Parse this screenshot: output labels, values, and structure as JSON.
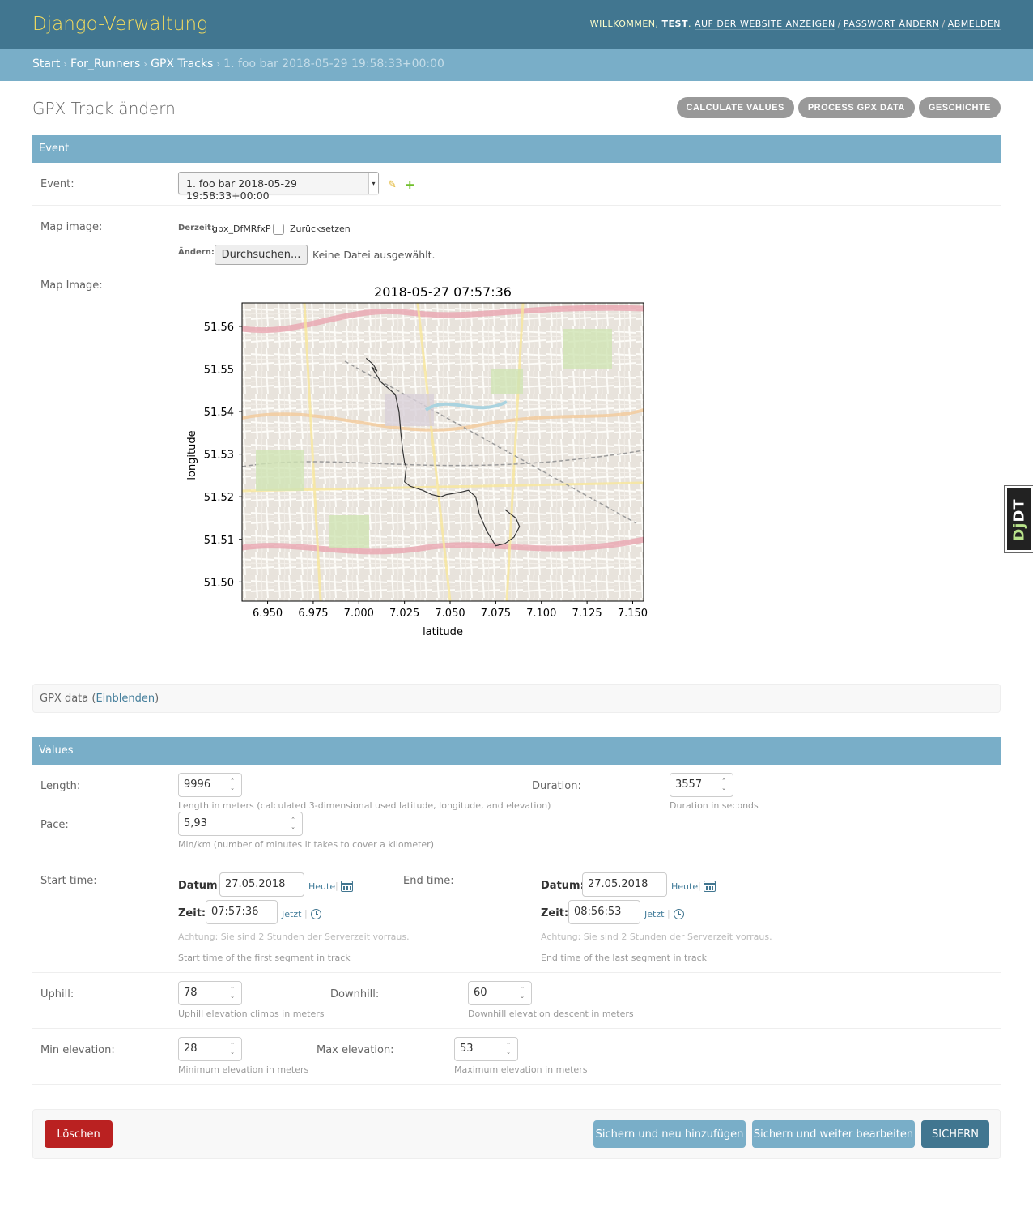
{
  "header": {
    "branding": "Django-Verwaltung",
    "welcome": "WILLKOMMEN,",
    "username": "TEST",
    "links": [
      "AUF DER WEBSITE ANZEIGEN",
      "PASSWORT ÄNDERN",
      "ABMELDEN"
    ]
  },
  "breadcrumbs": {
    "items": [
      "Start",
      "For_Runners",
      "GPX Tracks"
    ],
    "current": "1. foo bar 2018-05-29 19:58:33+00:00"
  },
  "page": {
    "title": "GPX Track ändern",
    "tools": [
      "CALCULATE VALUES",
      "PROCESS GPX DATA",
      "GESCHICHTE"
    ]
  },
  "event_module": {
    "header": "Event",
    "event_label": "Event:",
    "event_value": "1. foo bar 2018-05-29 19:58:33+00:00",
    "map_image_label": "Map image:",
    "current_label": "Derzeit:",
    "current_file": "gpx_DfMRfxP",
    "clear_label": "Zurücksetzen",
    "change_label": "Ändern:",
    "browse_button": "Durchsuchen...",
    "no_file": "Keine Datei ausgewählt.",
    "map_image_preview_label": "Map Image:"
  },
  "chart_data": {
    "type": "line",
    "title": "2018-05-27 07:57:36",
    "xlabel": "latitude",
    "ylabel": "longitude",
    "xlim": [
      6.936,
      7.156
    ],
    "ylim": [
      51.4955,
      51.5655
    ],
    "xticks": [
      "6.950",
      "6.975",
      "7.000",
      "7.025",
      "7.050",
      "7.075",
      "7.100",
      "7.125",
      "7.150"
    ],
    "yticks": [
      "51.50",
      "51.51",
      "51.52",
      "51.53",
      "51.54",
      "51.55",
      "51.56"
    ],
    "background": "OpenStreetMap tiles",
    "series": [
      {
        "color": "#333333",
        "x": [
          7.004,
          7.008,
          7.01,
          7.007,
          7.012,
          7.02,
          7.022,
          7.023,
          7.024,
          7.025,
          7.026,
          7.025,
          7.028,
          7.035,
          7.04,
          7.045,
          7.048,
          7.055,
          7.06,
          7.064,
          7.066,
          7.07,
          7.075,
          7.08,
          7.085,
          7.088,
          7.086,
          7.08
        ],
        "y": [
          51.5525,
          51.551,
          51.5495,
          51.5505,
          51.547,
          51.544,
          51.54,
          51.535,
          51.531,
          51.528,
          51.527,
          51.5235,
          51.5225,
          51.5215,
          51.5205,
          51.52,
          51.5205,
          51.521,
          51.5215,
          51.52,
          51.516,
          51.512,
          51.5085,
          51.509,
          51.5105,
          51.513,
          51.515,
          51.517
        ]
      }
    ]
  },
  "gpx_data": {
    "label": "GPX data",
    "toggle": "Einblenden"
  },
  "values_module": {
    "header": "Values",
    "length_label": "Length:",
    "length_value": "9996",
    "length_help": "Length in meters (calculated 3-dimensional used latitude, longitude, and elevation)",
    "duration_label": "Duration:",
    "duration_value": "3557",
    "duration_help": "Duration in seconds",
    "pace_label": "Pace:",
    "pace_value": "5,93",
    "pace_help": "Min/km (number of minutes it takes to cover a kilometer)",
    "start_time_label": "Start time:",
    "end_time_label": "End time:",
    "date_label": "Datum:",
    "time_label": "Zeit:",
    "start_date": "27.05.2018",
    "start_time": "07:57:36",
    "end_date": "27.05.2018",
    "end_time": "08:56:53",
    "today": "Heute",
    "now": "Jetzt",
    "timezone_warning": "Achtung: Sie sind 2 Stunden der Serverzeit vorraus.",
    "start_help": "Start time of the first segment in track",
    "end_help": "End time of the last segment in track",
    "uphill_label": "Uphill:",
    "uphill_value": "78",
    "uphill_help": "Uphill elevation climbs in meters",
    "downhill_label": "Downhill:",
    "downhill_value": "60",
    "downhill_help": "Downhill elevation descent in meters",
    "min_elev_label": "Min elevation:",
    "min_elev_value": "28",
    "min_elev_help": "Minimum elevation in meters",
    "max_elev_label": "Max elevation:",
    "max_elev_value": "53",
    "max_elev_help": "Maximum elevation in meters"
  },
  "submit": {
    "delete": "Löschen",
    "save_add": "Sichern und neu hinzufügen",
    "save_continue": "Sichern und weiter bearbeiten",
    "save": "SICHERN"
  },
  "debug_toolbar": {
    "label_a": "Dj",
    "label_b": "DT"
  },
  "colors": {
    "header_bg": "#417690",
    "breadcrumb_bg": "#79aec8",
    "branding": "#f5dd5d",
    "delete_btn": "#ba2121",
    "save_btn": "#417690",
    "secondary_btn": "#79aec8"
  }
}
